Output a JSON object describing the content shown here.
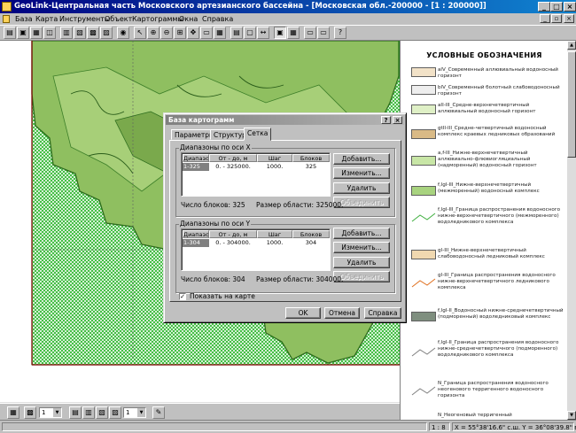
{
  "window": {
    "title": "GeoLink-Центральная часть Московского артезианского бассейна - [Московская обл.-200000 - [1 : 200000]]",
    "controls": [
      "_",
      "□",
      "×"
    ]
  },
  "menu": [
    "База",
    "Карта",
    "Инструменты",
    "Объект",
    "Картограммы",
    "Окна",
    "Справка"
  ],
  "toolbar": {
    "icons": [
      "open-icon",
      "save-icon",
      "print-icon",
      "layers-icon",
      "pointer-icon",
      "zoom-in-icon",
      "zoom-out-icon",
      "pan-icon",
      "ruler-icon",
      "table-icon",
      "chart-icon",
      "map-icon",
      "legend-icon",
      "grid-icon",
      "select-icon",
      "help-icon"
    ]
  },
  "legend": {
    "title": "УСЛОВНЫЕ ОБОЗНАЧЕНИЯ",
    "items": [
      {
        "text": "alV_Современный аллювиальный водоносный горизонт",
        "color": "#f2e2c8"
      },
      {
        "text": "blV_Современный болотный слабоводоносный горизонт",
        "color": "#eeeeee"
      },
      {
        "text": "aII-III_Средне-верхнечетвертичный аллювиальный водоносный горизонт",
        "color": "#dff0c6"
      },
      {
        "text": "gtII-III_Средне-четвертичный водоносный комплекс краевых ледниковых образований",
        "color": "#d9ba86"
      },
      {
        "text": "a,f-III_Нижне-верхнечетвертичный аллювиально-флювиогляциальный (надморенный) водоносный горизонт",
        "color": "#c8e6a6"
      },
      {
        "text": "f,lgI-III_Нижне-верхнечетвертичный (межморенный) водоносный комплекс",
        "color": "#a8d37f"
      },
      {
        "text": "f,lgI-III_Граница распространения водоносного нижне-верхнечетвертичного (межморенного) водоледникового комплекса",
        "color": "#ffffff"
      },
      {
        "text": "gI-III_Нижне-верхнечетвертичный слабоводоносный ледниковый комплекс",
        "color": "#f0d8b0"
      },
      {
        "text": "gI-III_Граница распространения водоносного нижне-верхнечетвертичного ледникового комплекса",
        "color": "#ffffff"
      },
      {
        "text": "f,lgI-II_Водоносный нижне-среднечетвертичный (подморенный) водоледниковый комплекс",
        "color": "#7f8f7f"
      },
      {
        "text": "f,lgI-II_Граница распространения водоносного нижне-среднечетвертичного (подморенного) водоледникового комплекса",
        "color": "#ffffff"
      },
      {
        "text": "N_Граница распространения водоносного неогенового терригенного водоносного горизонта",
        "color": "#ffffff"
      },
      {
        "text": "N_Неогеновый терригенный",
        "color": "#ffffff"
      }
    ]
  },
  "dialog": {
    "title": "База картограмм",
    "tabs": [
      "Параметры",
      "Структура",
      "Сетка"
    ],
    "active_tab": "Сетка",
    "x_group": {
      "label": "Диапазоны по оси X",
      "headers": [
        "Диапазон",
        "От - до, м",
        "Шаг",
        "Блоков"
      ],
      "rows": [
        [
          "1-325",
          "0. - 325000.",
          "1000.",
          "325"
        ]
      ],
      "blocks_text": "Число блоков: 325",
      "size_text": "Размер области: 325000."
    },
    "y_group": {
      "label": "Диапазоны по оси Y",
      "headers": [
        "Диапазон",
        "От - до, м",
        "Шаг",
        "Блоков"
      ],
      "rows": [
        [
          "1-304",
          "0. - 304000.",
          "1000.",
          "304"
        ]
      ],
      "blocks_text": "Число блоков: 304",
      "size_text": "Размер области: 304000."
    },
    "buttons": {
      "add": "Добавить...",
      "edit": "Изменить...",
      "delete": "Удалить",
      "merge": "Объединить"
    },
    "show_on_map_label": "Показать на карте",
    "show_on_map_checked": true,
    "ok": "OK",
    "cancel": "Отмена",
    "help": "Справка"
  },
  "bottom_toolbar": {
    "combo1": "1",
    "combo2": "1"
  },
  "status": {
    "scale": "1 : 8",
    "coords": "X = 55°38'16.6\" с.ш.  Y = 36°08'39.8\" в.д."
  }
}
